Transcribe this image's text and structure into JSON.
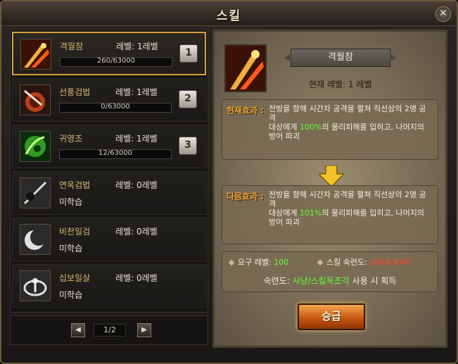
{
  "window": {
    "title": "스킬"
  },
  "skills": [
    {
      "name": "격월참",
      "level": "레벨:  1레벨",
      "progress": "260/63000",
      "progress_fraction": 0.004,
      "slot": "1",
      "selected": true,
      "icon": "slash-attack-icon"
    },
    {
      "name": "선풍검법",
      "level": "레벨:  1레벨",
      "progress": "0/63000",
      "progress_fraction": 0,
      "slot": "2",
      "selected": false,
      "icon": "whirlwind-sword-icon"
    },
    {
      "name": "귀영조",
      "level": "레벨:  1레벨",
      "progress": "12/63000",
      "progress_fraction": 0.0002,
      "slot": "3",
      "selected": false,
      "icon": "green-claw-icon"
    },
    {
      "name": "연옥검법",
      "level": "레벨:  0레벨",
      "status": "미학습",
      "icon": "shadow-sword-icon"
    },
    {
      "name": "비천일검",
      "level": "레벨:  0레벨",
      "status": "미학습",
      "icon": "crescent-slash-icon"
    },
    {
      "name": "십보일살",
      "level": "레벨:  0레벨",
      "status": "미학습",
      "icon": "spinning-kick-icon"
    }
  ],
  "pager": {
    "text": "1/2",
    "prev": "◀",
    "next": "▶"
  },
  "detail": {
    "name": "격월참",
    "current_level": "현재 레벨:   1 레벨",
    "current_effect_label": "현재효과 :",
    "current_effect_line1": "전방을 향해 시간차 공격을 펼쳐 직선상의 2명 공격",
    "current_effect_pre": "대상에게 ",
    "current_effect_pct": "100%",
    "current_effect_post": "의 물리피해를 입히고, 나머지의 방어 파괴",
    "next_effect_label": "다음효과 :",
    "next_effect_line1": "전방을 향해 시간차 공격을 펼쳐 직선상의 2명 공격",
    "next_effect_pre": "대상에게 ",
    "next_effect_pct": "101%",
    "next_effect_post": "의 물리피해를 입히고, 나머지의 방어 파괴",
    "req_level_label": "요구 레벨: ",
    "req_level_value": "100",
    "req_mastery_label": "스킬 숙련도: ",
    "req_mastery_value": "260/63000",
    "mastery_pre": "숙련도: ",
    "mastery_link": "사냥/스킬독조각",
    "mastery_post": " 사용 시 획득",
    "upgrade_label": "승급"
  },
  "colors": {
    "accent": "#d7a13a",
    "highlight_green": "#66ff33",
    "warning_red": "#ff4a2a",
    "button_orange": "#e07a20"
  }
}
